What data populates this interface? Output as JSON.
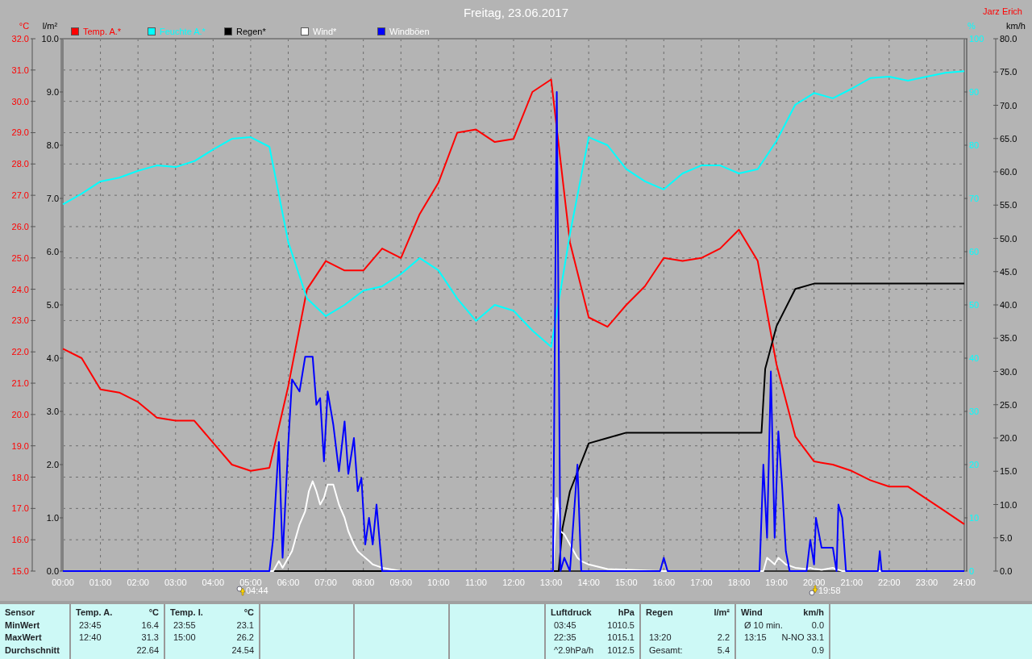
{
  "header": {
    "title": "Freitag, 23.06.2017",
    "author": "Jarz Erich"
  },
  "charts": [
    {
      "chart_data": {
        "type": "line",
        "grid": true,
        "ylabel": "°C",
        "xlim": [
          0,
          24
        ],
        "ylim": [
          15,
          32
        ],
        "x": [
          0,
          0.5,
          1,
          1.5,
          2,
          2.5,
          3,
          3.5,
          4,
          4.5,
          5,
          5.5,
          6,
          6.5,
          7,
          7.5,
          8,
          8.5,
          9,
          9.5,
          10,
          10.5,
          11,
          11.5,
          12,
          12.5,
          13,
          13.5,
          14,
          14.5,
          15,
          15.5,
          16,
          16.5,
          17,
          17.5,
          18,
          18.5,
          19,
          19.5,
          20,
          20.5,
          21,
          21.5,
          22,
          22.5,
          23,
          23.5,
          24
        ],
        "series": [
          {
            "name": "Temp. A.*",
            "color": "#ff0000",
            "values": [
              22.1,
              21.8,
              20.8,
              20.7,
              20.4,
              19.9,
              19.8,
              19.8,
              19.1,
              18.4,
              18.2,
              18.3,
              20.9,
              24.0,
              24.9,
              24.6,
              24.6,
              25.3,
              25.0,
              26.4,
              27.4,
              29.0,
              29.1,
              28.7,
              28.8,
              30.3,
              30.7,
              25.5,
              23.1,
              22.8,
              23.5,
              24.1,
              25.0,
              24.9,
              25.0,
              25.3,
              25.9,
              24.9,
              21.6,
              19.3,
              18.5,
              18.4,
              18.2,
              17.9,
              17.7,
              17.7,
              17.3,
              16.9,
              16.5
            ]
          }
        ],
        "xticks": [
          {
            "value": 0,
            "label": "00:00"
          },
          {
            "value": 1,
            "label": "01:00"
          },
          {
            "value": 2,
            "label": "02:00"
          },
          {
            "value": 3,
            "label": "03:00"
          },
          {
            "value": 4,
            "label": "04:00"
          },
          {
            "value": 5,
            "label": "05:00"
          },
          {
            "value": 6,
            "label": "06:00"
          },
          {
            "value": 7,
            "label": "07:00"
          },
          {
            "value": 8,
            "label": "08:00"
          },
          {
            "value": 9,
            "label": "09:00"
          },
          {
            "value": 10,
            "label": "10:00"
          },
          {
            "value": 11,
            "label": "11:00"
          },
          {
            "value": 12,
            "label": "12:00"
          },
          {
            "value": 13,
            "label": "13:00"
          },
          {
            "value": 14,
            "label": "14:00"
          },
          {
            "value": 15,
            "label": "15:00"
          },
          {
            "value": 16,
            "label": "16:00"
          },
          {
            "value": 17,
            "label": "17:00"
          },
          {
            "value": 18,
            "label": "18:00"
          },
          {
            "value": 19,
            "label": "19:00"
          },
          {
            "value": 20,
            "label": "20:00"
          },
          {
            "value": 21,
            "label": "21:00"
          },
          {
            "value": 22,
            "label": "22:00"
          },
          {
            "value": 23,
            "label": "23:00"
          },
          {
            "value": 24,
            "label": "24:00"
          }
        ],
        "yticks": [
          {
            "value": 15,
            "label": "15.0"
          },
          {
            "value": 16,
            "label": "16.0"
          },
          {
            "value": 17,
            "label": "17.0"
          },
          {
            "value": 18,
            "label": "18.0"
          },
          {
            "value": 19,
            "label": "19.0"
          },
          {
            "value": 20,
            "label": "20.0"
          },
          {
            "value": 21,
            "label": "21.0"
          },
          {
            "value": 22,
            "label": "22.0"
          },
          {
            "value": 23,
            "label": "23.0"
          },
          {
            "value": 24,
            "label": "24.0"
          },
          {
            "value": 25,
            "label": "25.0"
          },
          {
            "value": 26,
            "label": "26.0"
          },
          {
            "value": 27,
            "label": "27.0"
          },
          {
            "value": 28,
            "label": "28.0"
          },
          {
            "value": 29,
            "label": "29.0"
          },
          {
            "value": 30,
            "label": "30.0"
          },
          {
            "value": 31,
            "label": "31.0"
          },
          {
            "value": 32,
            "label": "32.0"
          }
        ]
      }
    },
    {
      "chart_data": {
        "type": "line",
        "ylabel": "l/m²",
        "xlim": [
          0,
          24
        ],
        "ylim": [
          0,
          10
        ],
        "x": [
          0,
          13.2,
          13.3,
          13.5,
          14,
          14.5,
          15,
          18.6,
          18.7,
          19,
          19.5,
          20,
          24
        ],
        "series": [
          {
            "name": "Regen*",
            "color": "#000000",
            "values": [
              0,
              0,
              0.8,
              1.5,
              2.4,
              2.5,
              2.6,
              2.6,
              3.8,
              4.6,
              5.3,
              5.4,
              5.4
            ]
          }
        ],
        "yticks": [
          {
            "value": 0,
            "label": "0.0"
          },
          {
            "value": 1,
            "label": "1.0"
          },
          {
            "value": 2,
            "label": "2.0"
          },
          {
            "value": 3,
            "label": "3.0"
          },
          {
            "value": 4,
            "label": "4.0"
          },
          {
            "value": 5,
            "label": "5.0"
          },
          {
            "value": 6,
            "label": "6.0"
          },
          {
            "value": 7,
            "label": "7.0"
          },
          {
            "value": 8,
            "label": "8.0"
          },
          {
            "value": 9,
            "label": "9.0"
          },
          {
            "value": 10,
            "label": "10.0"
          }
        ]
      }
    },
    {
      "chart_data": {
        "type": "line",
        "ylabel": "%",
        "xlim": [
          0,
          24
        ],
        "ylim": [
          0,
          100
        ],
        "x": [
          0,
          0.5,
          1,
          1.5,
          2,
          2.5,
          3,
          3.5,
          4,
          4.5,
          5,
          5.5,
          6,
          6.5,
          7,
          7.5,
          8,
          8.5,
          9,
          9.5,
          10,
          10.5,
          11,
          11.5,
          12,
          12.5,
          13,
          13.5,
          14,
          14.5,
          15,
          15.5,
          16,
          16.5,
          17,
          17.5,
          18,
          18.5,
          19,
          19.5,
          20,
          20.5,
          21,
          21.5,
          22,
          22.5,
          23,
          23.5,
          24
        ],
        "series": [
          {
            "name": "Feuchte A.*",
            "color": "#00ffff",
            "values": [
              68.9,
              70.9,
              73.2,
              73.9,
              75.2,
              76.2,
              75.9,
              77.0,
              79.2,
              81.2,
              81.5,
              79.7,
              61.8,
              51.2,
              47.9,
              50.0,
              52.7,
              53.5,
              55.8,
              58.8,
              56.5,
              51.2,
              47.0,
              50.0,
              48.9,
              45.2,
              42.1,
              63.3,
              81.5,
              80.0,
              75.5,
              73.2,
              71.7,
              74.7,
              76.2,
              76.2,
              74.7,
              75.5,
              80.8,
              87.6,
              89.8,
              88.8,
              90.6,
              92.6,
              92.9,
              92.1,
              92.9,
              93.6,
              93.9
            ]
          }
        ],
        "yticks": [
          0,
          10,
          20,
          30,
          40,
          50,
          60,
          70,
          80,
          90,
          100
        ]
      }
    },
    {
      "chart_data": {
        "type": "line",
        "ylabel": "km/h",
        "xlim": [
          0,
          24
        ],
        "ylim": [
          0,
          80
        ],
        "x": [
          0,
          5.5,
          5.6,
          5.75,
          5.85,
          6.0,
          6.1,
          6.3,
          6.45,
          6.55,
          6.65,
          6.75,
          6.85,
          6.95,
          7.05,
          7.2,
          7.35,
          7.5,
          7.6,
          7.75,
          7.85,
          7.95,
          8.05,
          8.15,
          8.25,
          8.35,
          8.5,
          9.0,
          13.05,
          13.15,
          13.25,
          13.35,
          13.5,
          13.7,
          13.8,
          14.0,
          14.5,
          15.9,
          16.0,
          16.1,
          18.55,
          18.65,
          18.75,
          18.85,
          18.95,
          19.05,
          19.15,
          19.25,
          19.35,
          19.5,
          19.8,
          19.9,
          20.0,
          20.05,
          20.2,
          20.5,
          20.6,
          20.65,
          20.75,
          20.85,
          21.7,
          21.75,
          21.8,
          24
        ],
        "series": [
          {
            "name": "Wind*",
            "color": "#ffffff",
            "values": [
              0,
              0,
              0,
              1.5,
              0.5,
              2,
              3,
              7,
              9,
              12,
              13.5,
              12,
              10,
              11,
              13,
              13,
              10,
              8,
              6,
              4,
              3,
              2.5,
              2,
              1.5,
              1,
              0.8,
              0.5,
              0,
              0,
              11,
              6,
              5.5,
              4,
              2,
              1.5,
              1,
              0.3,
              0,
              0,
              0,
              0,
              0,
              2,
              1.5,
              1,
              2,
              1.5,
              1,
              0.8,
              0.5,
              0.3,
              0.5,
              0.3,
              0.3,
              0.2,
              0.5,
              0.2,
              0.2,
              0,
              0,
              0,
              0,
              0,
              0
            ]
          },
          {
            "name": "Windböen",
            "color": "#0000ff",
            "values": [
              0,
              0,
              5,
              19.4,
              2,
              19,
              28.8,
              27,
              32.2,
              32.2,
              32.2,
              25,
              26,
              16.5,
              27,
              22,
              15,
              22.5,
              14.6,
              20,
              12,
              14,
              4,
              8,
              4,
              10,
              0,
              0,
              0,
              72,
              0,
              2,
              0,
              16,
              0,
              0,
              0,
              0,
              2,
              0,
              0,
              16,
              5,
              30,
              5,
              21,
              12.7,
              3,
              0,
              0,
              0,
              4.7,
              1,
              8,
              3.5,
              3.5,
              0,
              10,
              8,
              0,
              0,
              3,
              0,
              0
            ]
          }
        ],
        "yticks": [
          {
            "value": 0,
            "label": "0.0"
          },
          {
            "value": 5,
            "label": "5.0"
          },
          {
            "value": 10,
            "label": "10.0"
          },
          {
            "value": 15,
            "label": "15.0"
          },
          {
            "value": 20,
            "label": "20.0"
          },
          {
            "value": 25,
            "label": "25.0"
          },
          {
            "value": 30,
            "label": "30.0"
          },
          {
            "value": 35,
            "label": "35.0"
          },
          {
            "value": 40,
            "label": "40.0"
          },
          {
            "value": 45,
            "label": "45.0"
          },
          {
            "value": 50,
            "label": "50.0"
          },
          {
            "value": 55,
            "label": "55.0"
          },
          {
            "value": 60,
            "label": "60.0"
          },
          {
            "value": 65,
            "label": "65.0"
          },
          {
            "value": 70,
            "label": "70.0"
          },
          {
            "value": 75,
            "label": "75.0"
          },
          {
            "value": 80,
            "label": "80.0"
          }
        ]
      }
    }
  ],
  "sun": [
    {
      "kind": "sunrise",
      "label": "04:44"
    },
    {
      "kind": "sunset",
      "label": "19:58"
    }
  ],
  "stats": {
    "row_labels": [
      "Sensor",
      "MinWert",
      "MaxWert",
      "Durchschnitt"
    ],
    "columns": [
      {
        "name": "Temp. A.",
        "unit": "°C",
        "rows": [
          {
            "time": "23:45",
            "value": "16.4"
          },
          {
            "time": "12:40",
            "value": "31.3"
          },
          {
            "value": "22.64"
          }
        ]
      },
      {
        "name": "Temp. I.",
        "unit": "°C",
        "rows": [
          {
            "time": "23:55",
            "value": "23.1"
          },
          {
            "time": "15:00",
            "value": "26.2"
          },
          {
            "value": "24.54"
          }
        ]
      },
      {},
      {},
      {},
      {
        "name": "Luftdruck",
        "unit": "hPa",
        "rows": [
          {
            "time": "03:45",
            "value": "1010.5"
          },
          {
            "time": "22:35",
            "value": "1015.1"
          },
          {
            "time": "^2.9hPa/h",
            "value": "1012.5"
          }
        ]
      },
      {
        "name": "Regen",
        "unit": "l/m²",
        "rows": [
          {},
          {
            "time": "13:20",
            "value": "2.2"
          },
          {
            "time": "Gesamt:",
            "value": "5.4"
          }
        ]
      },
      {
        "name": "Wind",
        "unit": "km/h",
        "rows": [
          {
            "time": "Ø 10 min.",
            "value": "0.0"
          },
          {
            "time": "13:15",
            "value": "N-NO 33.1"
          },
          {
            "value": "0.9"
          }
        ]
      }
    ]
  }
}
